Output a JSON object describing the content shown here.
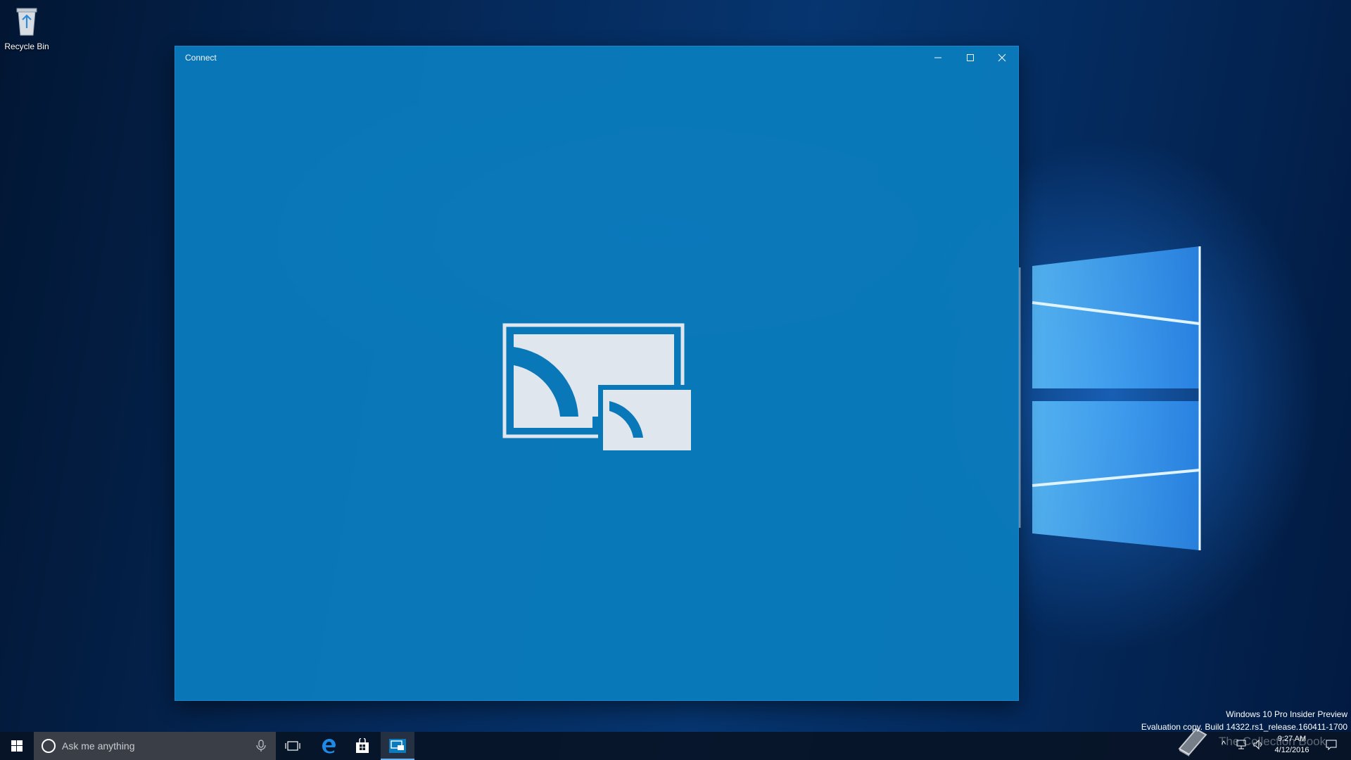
{
  "desktop": {
    "icons": [
      {
        "label": "Recycle Bin",
        "icon": "recycle-bin-icon"
      }
    ]
  },
  "window": {
    "title": "Connect",
    "controls": {
      "minimize": "minimize-icon",
      "maximize": "maximize-icon",
      "close": "close-icon"
    },
    "center_icon": "connect-cast-icon",
    "background": "#0a7bbc"
  },
  "watermark": {
    "line1": "Windows 10 Pro Insider Preview",
    "line2": "Evaluation copy. Build 14322.rs1_release.160411-1700"
  },
  "overlay_logo": {
    "text": "The Collection Book"
  },
  "taskbar": {
    "search_placeholder": "Ask me anything",
    "pinned": [
      "task-view-icon",
      "edge-icon",
      "store-icon",
      "connect-app-icon"
    ],
    "clock": {
      "time": "9:27 AM",
      "date": "4/12/2016"
    },
    "tray_icons": [
      "chevron-up-icon",
      "network-icon",
      "volume-icon",
      "action-center-icon"
    ]
  },
  "colors": {
    "accent": "#0a7bbc",
    "taskbar": "#08141f"
  }
}
